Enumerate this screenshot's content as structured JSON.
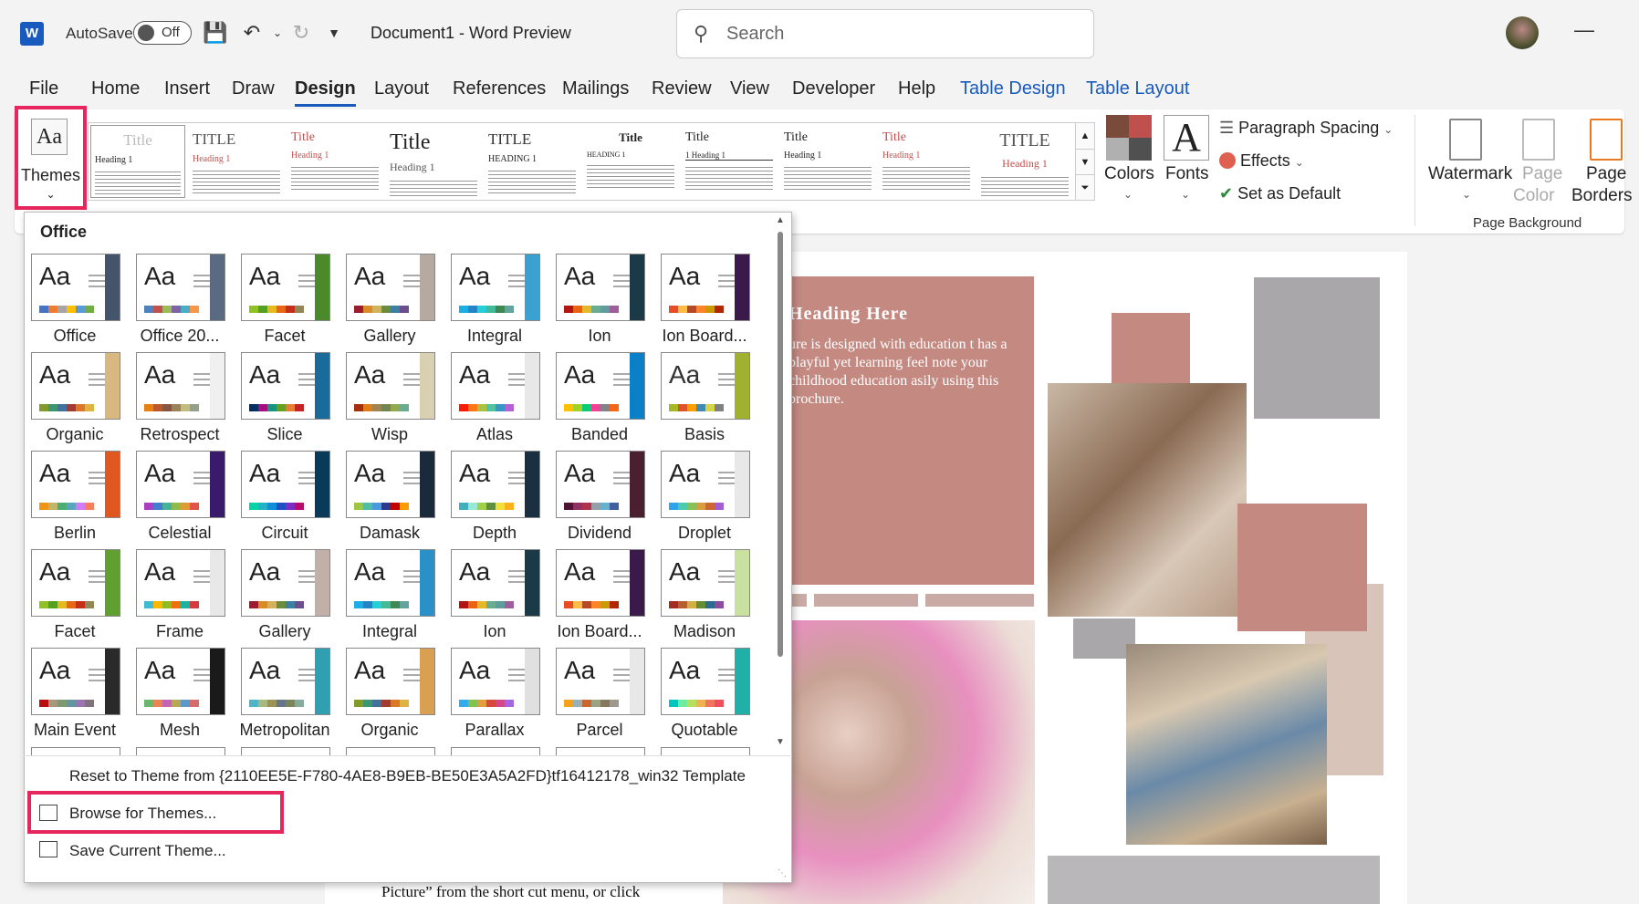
{
  "app": {
    "autosave_label": "AutoSave",
    "autosave_state": "Off",
    "document_title": "Document1  -  Word Preview",
    "search_placeholder": "Search"
  },
  "menu_tabs": [
    "File",
    "Home",
    "Insert",
    "Draw",
    "Design",
    "Layout",
    "References",
    "Mailings",
    "Review",
    "View",
    "Developer",
    "Help",
    "Table Design",
    "Table Layout"
  ],
  "ribbon": {
    "themes_label": "Themes",
    "styles_gallery": [
      {
        "title": "Title",
        "heading": "Heading 1"
      },
      {
        "title": "TITLE",
        "heading": "Heading 1"
      },
      {
        "title": "Title",
        "heading": "Heading 1"
      },
      {
        "title": "Title",
        "heading": "Heading 1"
      },
      {
        "title": "TITLE",
        "heading": "HEADING 1"
      },
      {
        "title": "Title",
        "heading": "HEADING 1"
      },
      {
        "title": "Title",
        "heading": "1 Heading 1"
      },
      {
        "title": "Title",
        "heading": "Heading 1"
      },
      {
        "title": "Title",
        "heading": "Heading 1"
      },
      {
        "title": "TITLE",
        "heading": "Heading 1"
      }
    ],
    "colors_label": "Colors",
    "fonts_label": "Fonts",
    "paragraph_spacing_label": "Paragraph Spacing",
    "effects_label": "Effects",
    "set_default_label": "Set as Default",
    "watermark_label": "Watermark",
    "page_color_label_1": "Page",
    "page_color_label_2": "Color",
    "page_borders_label_1": "Page",
    "page_borders_label_2": "Borders",
    "page_background_group": "Page Background"
  },
  "dropdown": {
    "section_header": "Office",
    "themes": [
      {
        "name": "Office",
        "accent": "#44546a",
        "colors": [
          "#4472c4",
          "#ed7d31",
          "#a5a5a5",
          "#ffc000",
          "#5b9bd5",
          "#70ad47"
        ]
      },
      {
        "name": "Office 20...",
        "accent": "#5a6a80",
        "colors": [
          "#4f81bd",
          "#c0504d",
          "#9bbb59",
          "#8064a2",
          "#4bacc6",
          "#f79646"
        ]
      },
      {
        "name": "Facet",
        "accent": "#4a8a2a",
        "colors": [
          "#90c226",
          "#54a021",
          "#e6b91e",
          "#e76618",
          "#c42f1a",
          "#918655"
        ]
      },
      {
        "name": "Gallery",
        "accent": "#b5a9a0",
        "colors": [
          "#9c1b2e",
          "#d98b27",
          "#d2b25c",
          "#6c8c3c",
          "#3d7fa3",
          "#6b4e8e"
        ]
      },
      {
        "name": "Integral",
        "accent": "#3aa0d0",
        "colors": [
          "#1cade4",
          "#2683c6",
          "#27ced7",
          "#42ba97",
          "#3e8853",
          "#62a39f"
        ]
      },
      {
        "name": "Ion",
        "accent": "#1a3a48",
        "colors": [
          "#b01513",
          "#ea6312",
          "#e6b729",
          "#6aac90",
          "#5f9c9d",
          "#9e5e9b"
        ]
      },
      {
        "name": "Ion Board...",
        "accent": "#3a1a4a",
        "colors": [
          "#e84c22",
          "#ffbd47",
          "#b64926",
          "#ff8427",
          "#cc9900",
          "#b22600"
        ]
      },
      {
        "name": "Organic",
        "accent": "#d8b880",
        "colors": [
          "#83992a",
          "#3c9770",
          "#44709d",
          "#a23c33",
          "#d97828",
          "#deb340"
        ]
      },
      {
        "name": "Retrospect",
        "accent": "#f0f0f0",
        "colors": [
          "#e48312",
          "#bd582c",
          "#865640",
          "#9b8357",
          "#c2bc80",
          "#94a088"
        ]
      },
      {
        "name": "Slice",
        "accent": "#1a6a9a",
        "colors": [
          "#052f61",
          "#a50e82",
          "#14967c",
          "#6a9e1f",
          "#e87d37",
          "#c62324"
        ]
      },
      {
        "name": "Wisp",
        "accent": "#d8d0b0",
        "colors": [
          "#a53010",
          "#de7e18",
          "#9f8351",
          "#728653",
          "#92aa4c",
          "#6aac91"
        ]
      },
      {
        "name": "Atlas",
        "accent": "#e8e8e8",
        "colors": [
          "#f81b02",
          "#fc7715",
          "#afbf41",
          "#50c49f",
          "#3b95c4",
          "#b560d4"
        ]
      },
      {
        "name": "Banded",
        "accent": "#0a80c8",
        "colors": [
          "#ffc000",
          "#a5d028",
          "#08cc78",
          "#f24099",
          "#828288",
          "#f56617"
        ]
      },
      {
        "name": "Basis",
        "accent": "#a0b030",
        "colors": [
          "#a6b727",
          "#df5327",
          "#fe9e00",
          "#418ab3",
          "#d7d447",
          "#818183"
        ]
      },
      {
        "name": "Berlin",
        "accent": "#e05820",
        "colors": [
          "#f09415",
          "#c1b56b",
          "#4baf73",
          "#5aa6c0",
          "#d17df9",
          "#fa7e5c"
        ]
      },
      {
        "name": "Celestial",
        "accent": "#3a1a6a",
        "colors": [
          "#ac3ec1",
          "#477bd1",
          "#46b298",
          "#90ba4c",
          "#dd9d31",
          "#e25247"
        ]
      },
      {
        "name": "Circuit",
        "accent": "#0a3a5a",
        "colors": [
          "#03d4a8",
          "#21b2c8",
          "#0f8cdc",
          "#1f4fc4",
          "#7d2cc4",
          "#b80c6c"
        ]
      },
      {
        "name": "Damask",
        "accent": "#1a2a3a",
        "colors": [
          "#9ec544",
          "#50bea3",
          "#4a9bdc",
          "#2b3a8f",
          "#c00000",
          "#ff9900"
        ]
      },
      {
        "name": "Depth",
        "accent": "#1a3040",
        "colors": [
          "#41aebd",
          "#97e9d5",
          "#a2cf49",
          "#608f3d",
          "#f4de3a",
          "#fcb11c"
        ]
      },
      {
        "name": "Dividend",
        "accent": "#4a2030",
        "colors": [
          "#4d1434",
          "#903163",
          "#b2324b",
          "#969fa7",
          "#66b1ce",
          "#40619d"
        ]
      },
      {
        "name": "Droplet",
        "accent": "#e8e8e8",
        "colors": [
          "#2fa3ee",
          "#4bcaad",
          "#86c157",
          "#d99c3f",
          "#ce6633",
          "#a35dd1"
        ]
      },
      {
        "name": "Facet",
        "accent": "#60a030",
        "colors": [
          "#90c226",
          "#54a021",
          "#e6b91e",
          "#e76618",
          "#c42f1a",
          "#918655"
        ]
      },
      {
        "name": "Frame",
        "accent": "#e8e8e8",
        "colors": [
          "#40bad2",
          "#fab900",
          "#90bb23",
          "#ee7008",
          "#1ab39f",
          "#d5393d"
        ]
      },
      {
        "name": "Gallery",
        "accent": "#c0b0a8",
        "colors": [
          "#9c1b2e",
          "#d98b27",
          "#d2b25c",
          "#6c8c3c",
          "#3d7fa3",
          "#6b4e8e"
        ]
      },
      {
        "name": "Integral",
        "accent": "#2a90c8",
        "colors": [
          "#1cade4",
          "#2683c6",
          "#27ced7",
          "#42ba97",
          "#3e8853",
          "#62a39f"
        ]
      },
      {
        "name": "Ion",
        "accent": "#1a3a48",
        "colors": [
          "#b01513",
          "#ea6312",
          "#e6b729",
          "#6aac90",
          "#5f9c9d",
          "#9e5e9b"
        ]
      },
      {
        "name": "Ion Board...",
        "accent": "#3a1a4a",
        "colors": [
          "#e84c22",
          "#ffbd47",
          "#b64926",
          "#ff8427",
          "#cc9900",
          "#b22600"
        ]
      },
      {
        "name": "Madison",
        "accent": "#c8e0a0",
        "colors": [
          "#a32b21",
          "#b75e2f",
          "#d3ae45",
          "#648c32",
          "#2d6a8f",
          "#8c4ca0"
        ]
      },
      {
        "name": "Main Event",
        "accent": "#2a2a2a",
        "colors": [
          "#b80e0f",
          "#a6987d",
          "#7f9a71",
          "#64969f",
          "#9b75b2",
          "#80737a"
        ]
      },
      {
        "name": "Mesh",
        "accent": "#1a1a1a",
        "colors": [
          "#6bb76d",
          "#e88651",
          "#c664b7",
          "#b8a65b",
          "#5c99c8",
          "#d86b6b"
        ]
      },
      {
        "name": "Metropolitan",
        "accent": "#30a0b0",
        "colors": [
          "#50b4c8",
          "#a8b97f",
          "#9b9256",
          "#657689",
          "#7a855d",
          "#84ac9d"
        ]
      },
      {
        "name": "Organic",
        "accent": "#d8a050",
        "colors": [
          "#83992a",
          "#3c9770",
          "#44709d",
          "#a23c33",
          "#d97828",
          "#deb340"
        ]
      },
      {
        "name": "Parallax",
        "accent": "#e0e0e0",
        "colors": [
          "#30acec",
          "#80c34f",
          "#e29d3e",
          "#d64a3b",
          "#d64787",
          "#a666e1"
        ]
      },
      {
        "name": "Parcel",
        "accent": "#e8e8e8",
        "colors": [
          "#f6a21d",
          "#9bafb5",
          "#c96731",
          "#9ca383",
          "#87795d",
          "#a0988c"
        ]
      },
      {
        "name": "Quotable",
        "accent": "#20b0a8",
        "colors": [
          "#00c6bb",
          "#6feba0",
          "#b6df5e",
          "#efb251",
          "#ef755f",
          "#ed515c"
        ]
      }
    ],
    "reset_label": "Reset to Theme from {2110EE5E-F780-4AE8-B9EB-BE50E3A5A2FD}tf16412178_win32 Template",
    "browse_label": "Browse for Themes...",
    "save_label": "Save Current Theme..."
  },
  "document": {
    "heading": "Heading Here",
    "body": "ure is designed with education t has a playful yet learning feel note your childhood education asily using this brochure.",
    "bottom_text": "Picture” from the short cut menu, or click"
  },
  "colors": {
    "highlight": "#e8265e",
    "word_blue": "#185abd",
    "brochure_rose": "#c48a82"
  }
}
